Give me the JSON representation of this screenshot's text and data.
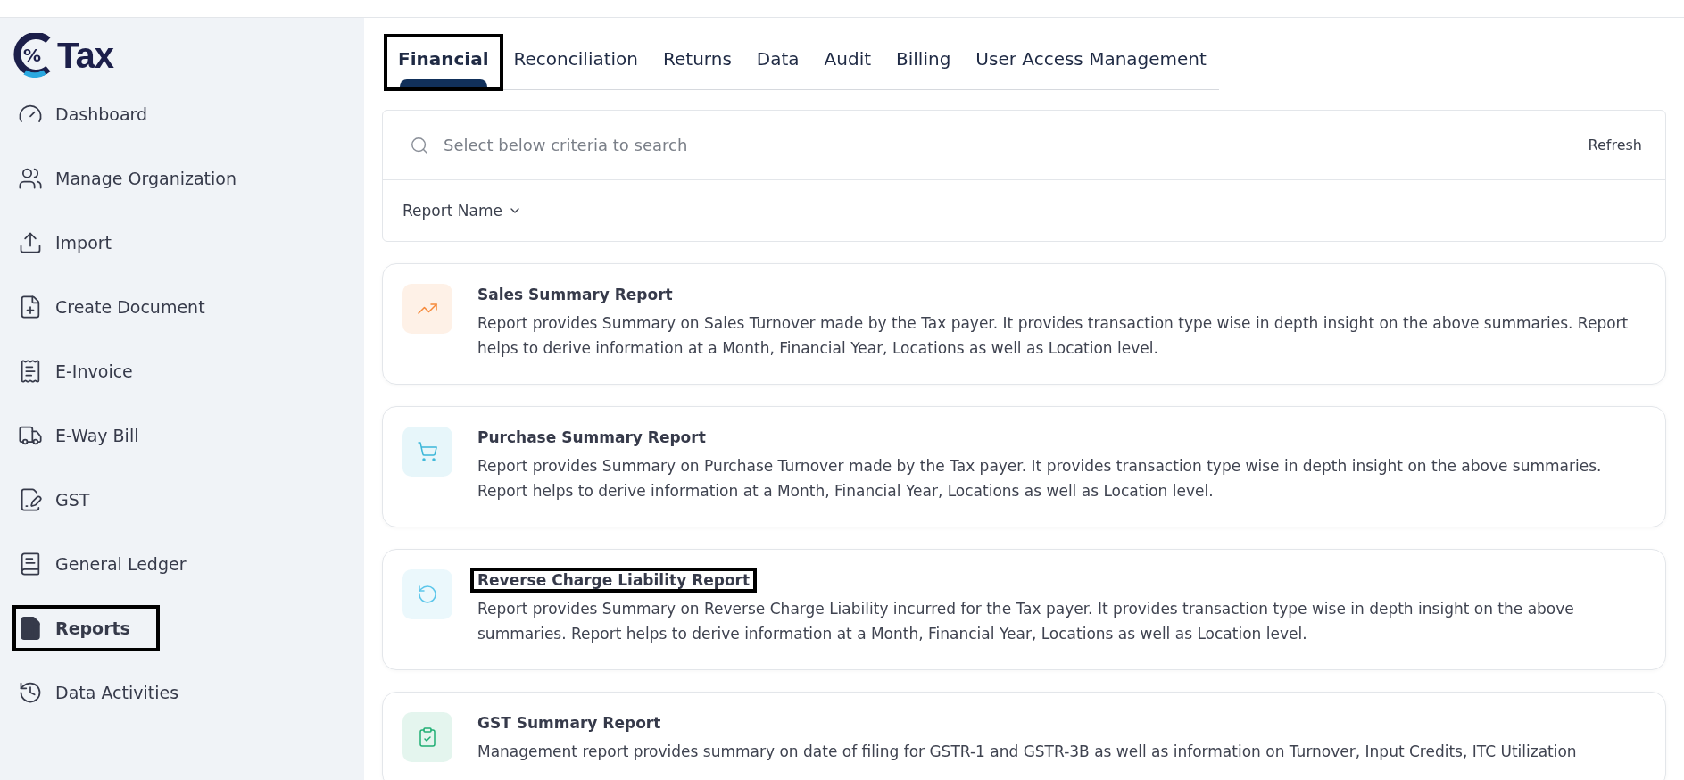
{
  "logo": {
    "mark": "%",
    "text": "Tax"
  },
  "sidebar": {
    "items": [
      {
        "label": "Dashboard",
        "selected": false,
        "highlighted": false
      },
      {
        "label": "Manage Organization",
        "selected": false,
        "highlighted": false
      },
      {
        "label": "Import",
        "selected": false,
        "highlighted": false
      },
      {
        "label": "Create Document",
        "selected": false,
        "highlighted": false
      },
      {
        "label": "E-Invoice",
        "selected": false,
        "highlighted": false
      },
      {
        "label": "E-Way Bill",
        "selected": false,
        "highlighted": false
      },
      {
        "label": "GST",
        "selected": false,
        "highlighted": false
      },
      {
        "label": "General Ledger",
        "selected": false,
        "highlighted": false
      },
      {
        "label": "Reports",
        "selected": true,
        "highlighted": true
      },
      {
        "label": "Data Activities",
        "selected": false,
        "highlighted": false
      }
    ]
  },
  "tabs": [
    {
      "label": "Financial",
      "selected": true,
      "highlighted": true
    },
    {
      "label": "Reconciliation",
      "selected": false,
      "highlighted": false
    },
    {
      "label": "Returns",
      "selected": false,
      "highlighted": false
    },
    {
      "label": "Data",
      "selected": false,
      "highlighted": false
    },
    {
      "label": "Audit",
      "selected": false,
      "highlighted": false
    },
    {
      "label": "Billing",
      "selected": false,
      "highlighted": false
    },
    {
      "label": "User Access Management",
      "selected": false,
      "highlighted": false
    }
  ],
  "search": {
    "placeholder": "Select below criteria to search",
    "refresh": "Refresh",
    "filter": "Report Name"
  },
  "reports_list": [
    {
      "title": "Sales Summary Report",
      "color": "#f5893a",
      "highlighted": false,
      "description": "Report provides Summary on Sales Turnover made by the Tax payer. It provides transaction type wise in depth insight on the above summaries. Report helps to derive information at a Month, Financial Year, Locations as well as Location level."
    },
    {
      "title": "Purchase Summary Report",
      "color": "#3bb7d9",
      "highlighted": false,
      "description": "Report provides Summary on Purchase Turnover made by the Tax payer. It provides transaction type wise in depth insight on the above summaries. Report helps to derive information at a Month, Financial Year, Locations as well as Location level."
    },
    {
      "title": "Reverse Charge Liability Report",
      "color": "#5cc6ea",
      "highlighted": true,
      "description": "Report provides Summary on Reverse Charge Liability incurred for the Tax payer. It provides transaction type wise in depth insight on the above summaries. Report helps to derive information at a Month, Financial Year, Locations as well as Location level."
    },
    {
      "title": "GST Summary Report",
      "color": "#1fae74",
      "highlighted": false,
      "description": "Management report provides summary on date of filing for GSTR-1 and GSTR-3B as well as information on Turnover, Input Credits, ITC Utilization"
    }
  ]
}
